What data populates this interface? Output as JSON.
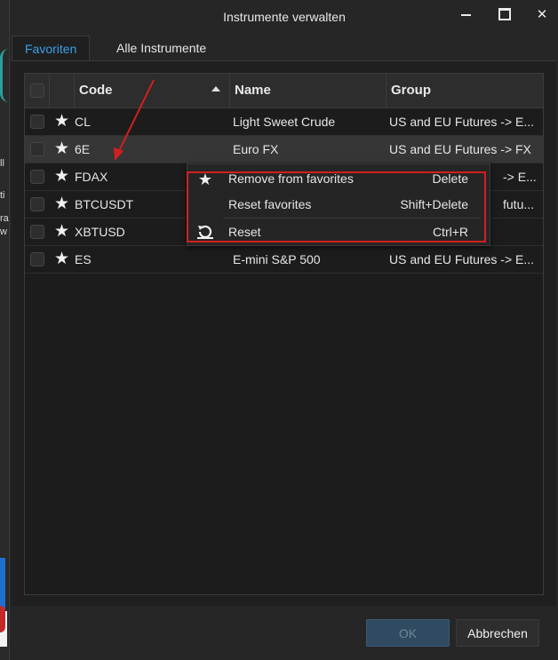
{
  "window": {
    "title": "Instrumente verwalten"
  },
  "tabs": [
    {
      "label": "Favoriten",
      "active": true
    },
    {
      "label": "Alle Instrumente",
      "active": false
    }
  ],
  "table": {
    "headers": {
      "code": "Code",
      "name": "Name",
      "group": "Group"
    },
    "rows": [
      {
        "code": "CL",
        "name": "Light Sweet Crude",
        "group": "US and EU Futures -> E..."
      },
      {
        "code": "6E",
        "name": "Euro FX",
        "group": "US and EU Futures -> FX"
      },
      {
        "code": "FDAX",
        "name": "",
        "group": "-> E..."
      },
      {
        "code": "BTCUSDT",
        "name": "",
        "group": "futu..."
      },
      {
        "code": "XBTUSD",
        "name": "",
        "group": ""
      },
      {
        "code": "ES",
        "name": "E-mini S&P 500",
        "group": "US and EU Futures -> E..."
      }
    ]
  },
  "context_menu": {
    "items": [
      {
        "label": "Remove from favorites",
        "shortcut": "Delete",
        "icon": "star-remove-icon"
      },
      {
        "label": "Reset favorites",
        "shortcut": "Shift+Delete",
        "icon": ""
      },
      {
        "label": "Reset",
        "shortcut": "Ctrl+R",
        "icon": "reset-icon"
      }
    ]
  },
  "buttons": {
    "ok": "OK",
    "cancel": "Abbrechen"
  },
  "background_text": [
    "ll",
    "ti",
    "ra",
    "w"
  ],
  "colors": {
    "accent": "#3aa0e8",
    "annotation": "#d21f1f",
    "ok_disabled": "#2f4a61"
  }
}
